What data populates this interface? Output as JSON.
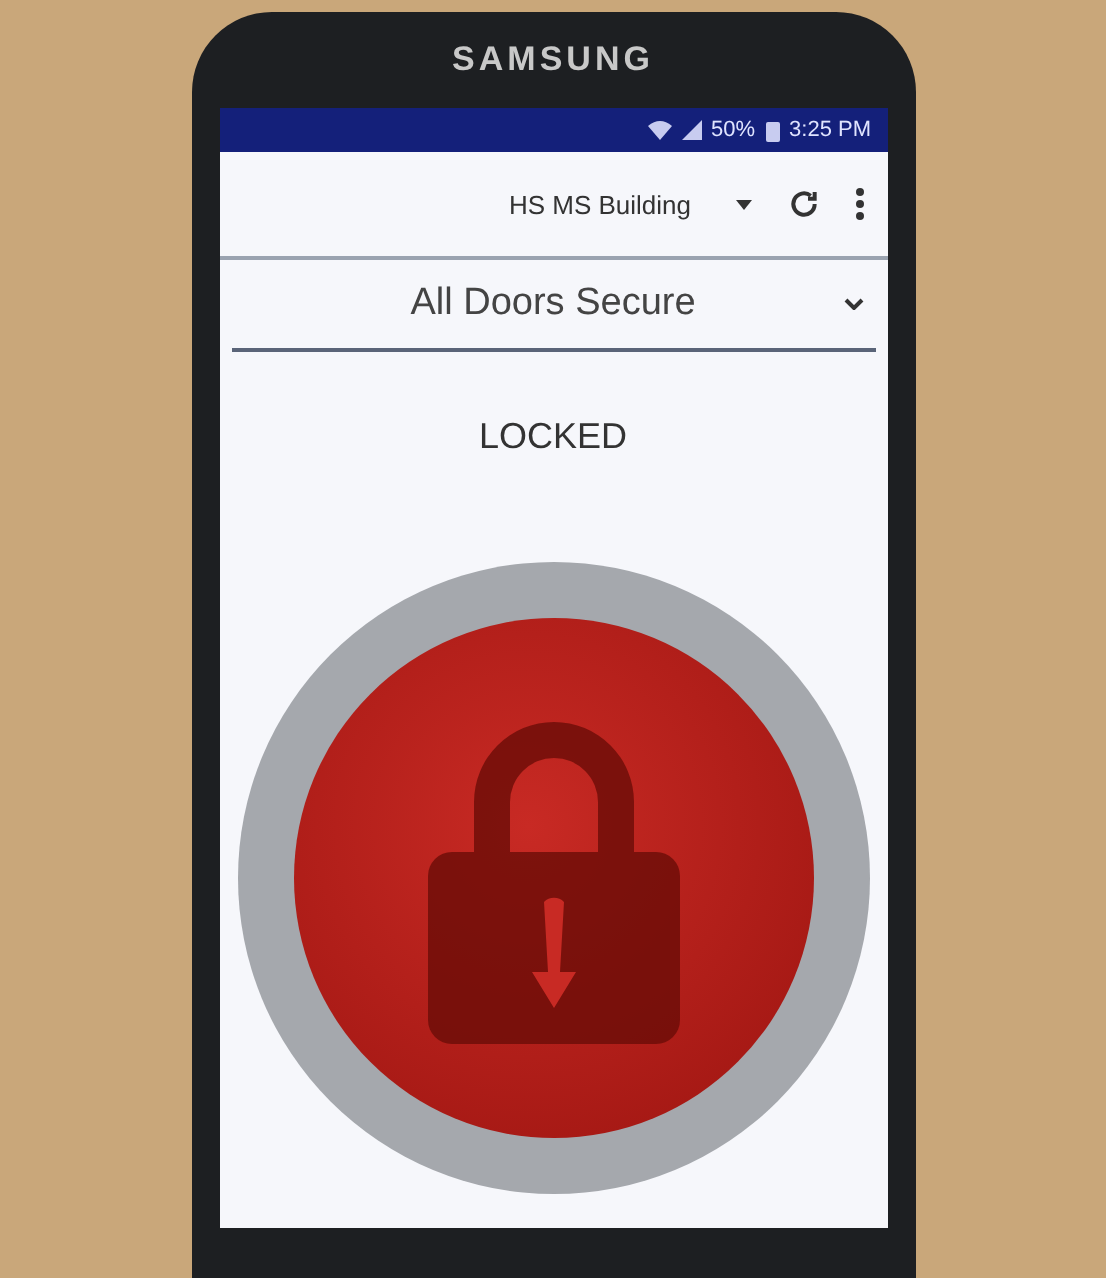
{
  "phone": {
    "brand": "SAMSUNG"
  },
  "status_bar": {
    "battery": "50%",
    "time": "3:25 PM"
  },
  "toolbar": {
    "building": "HS MS Building"
  },
  "door_status": {
    "value": "All Doors Secure"
  },
  "lock": {
    "label": "LOCKED",
    "locked": true
  }
}
